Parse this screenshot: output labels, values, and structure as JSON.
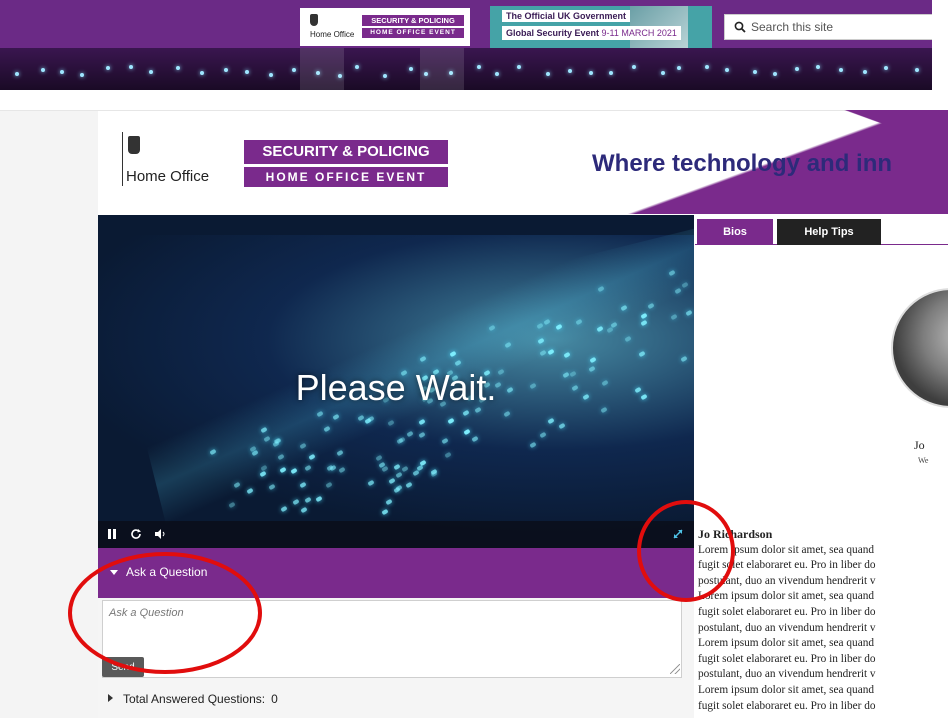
{
  "top_banner": {
    "logo": {
      "org": "Home Office",
      "event_line1": "SECURITY & POLICING",
      "event_line2": "HOME OFFICE EVENT"
    },
    "event_ad": {
      "line1": "The Official UK Government",
      "line2": "Global Security Event",
      "dates": "9-11 MARCH 2021"
    },
    "search": {
      "placeholder": "Search this site"
    }
  },
  "header": {
    "org": "Home Office",
    "event_line1": "SECURITY & POLICING",
    "event_line2": "HOME OFFICE EVENT",
    "tagline": "Where technology and inn"
  },
  "video": {
    "overlay_text": "Please Wait.",
    "controls": [
      "pause-icon",
      "refresh-icon",
      "volume-icon",
      "expand-icon"
    ]
  },
  "ask_question": {
    "title": "Ask a Question",
    "placeholder": "Ask a Question",
    "send_label": "Send",
    "answered_label": "Total Answered Questions:",
    "answered_count": "0"
  },
  "tabs": [
    "Bios",
    "Help Tips"
  ],
  "bio": {
    "name_short": "Jo",
    "subtitle_short": "We",
    "name": "Jo Richardson",
    "lines": [
      "Lorem ipsum dolor sit amet, sea quand",
      "fugit solet elaboraret eu. Pro in liber do",
      "postulant, duo an vivendum hendrerit v",
      "Lorem ipsum dolor sit amet, sea quand",
      "fugit solet elaboraret eu. Pro in liber do",
      "postulant, duo an vivendum hendrerit v",
      "Lorem ipsum dolor sit amet, sea quand",
      "fugit solet elaboraret eu. Pro in liber do",
      "postulant, duo an vivendum hendrerit v",
      "Lorem ipsum dolor sit amet, sea quand",
      "fugit solet elaboraret eu. Pro in liber do"
    ]
  },
  "colors": {
    "brand_purple": "#7a2a8c",
    "annotation_red": "#e10d0d",
    "tagline_navy": "#2d2a7a"
  }
}
